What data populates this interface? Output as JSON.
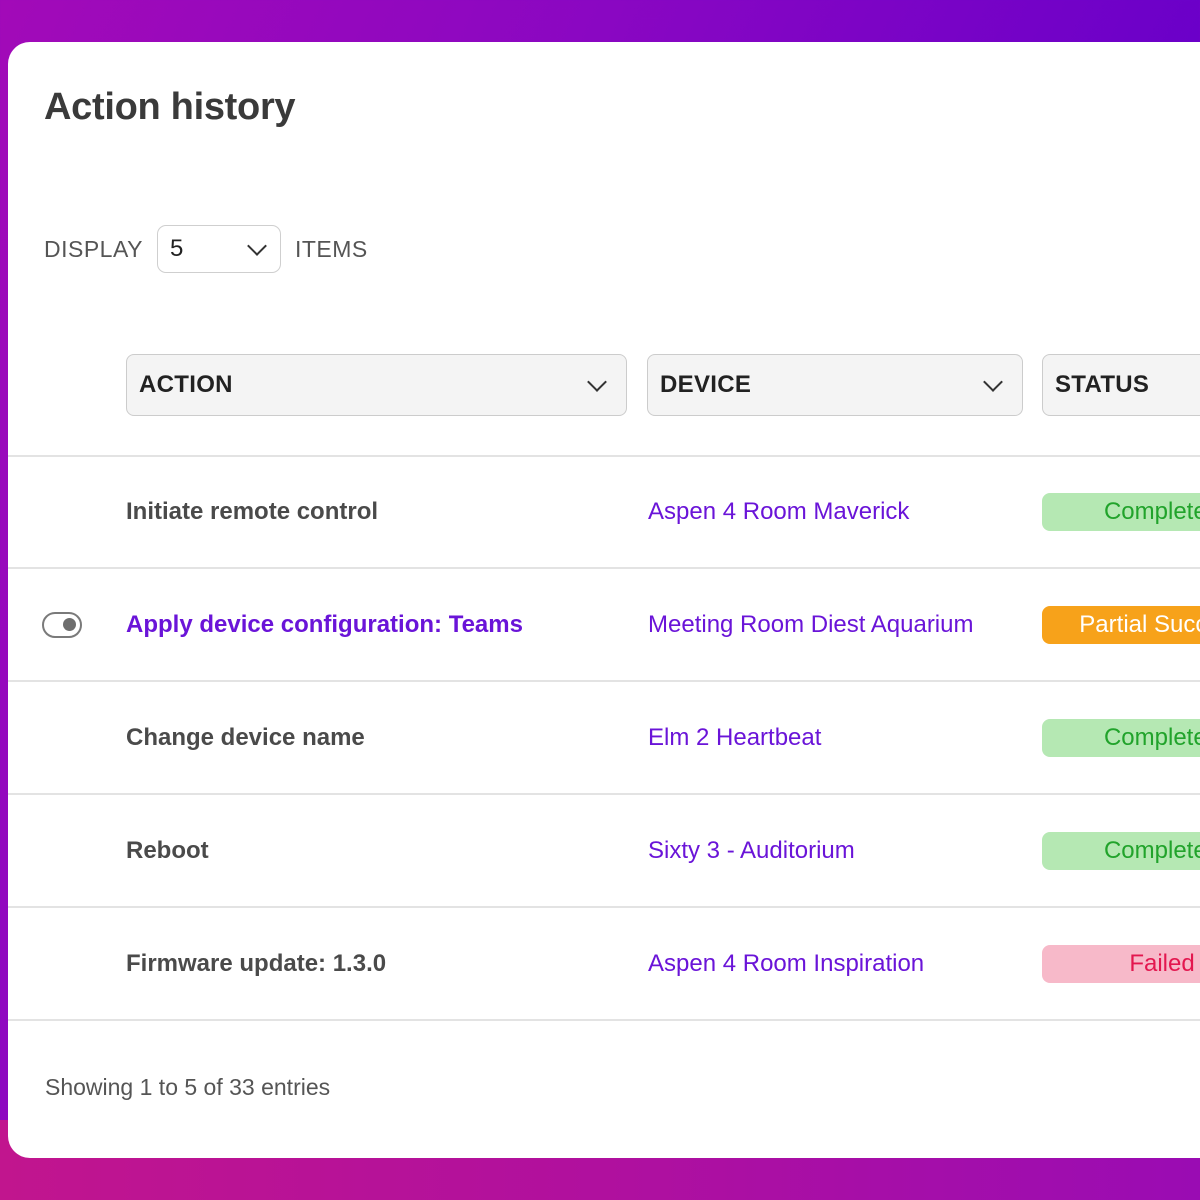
{
  "page": {
    "title": "Action history"
  },
  "display": {
    "label": "DISPLAY",
    "value": "5",
    "suffix": "ITEMS"
  },
  "filters": {
    "action": "ACTION",
    "device": "DEVICE",
    "status": "STATUS"
  },
  "rows": [
    {
      "action": "Initiate remote control",
      "device": "Aspen 4 Room Maverick",
      "status": "Completed",
      "status_type": "completed"
    },
    {
      "action": "Apply device configuration: Teams",
      "device": "Meeting Room Diest Aquarium",
      "status": "Partial Success",
      "status_type": "partial"
    },
    {
      "action": "Change device name",
      "device": "Elm 2 Heartbeat",
      "status": "Completed",
      "status_type": "completed"
    },
    {
      "action": "Reboot",
      "device": "Sixty 3 - Auditorium",
      "status": "Completed",
      "status_type": "completed"
    },
    {
      "action": "Firmware update: 1.3.0",
      "device": "Aspen 4 Room Inspiration",
      "status": "Failed",
      "status_type": "failed"
    }
  ],
  "footer": {
    "entries": "Showing 1 to 5 of 33 entries"
  },
  "colors": {
    "link": "#6a14d8",
    "completed_bg": "#b5e8b3",
    "completed_text": "#21a32b",
    "partial_bg": "#f7a21a",
    "failed_bg": "#f7b9c9",
    "failed_text": "#e3174f"
  }
}
